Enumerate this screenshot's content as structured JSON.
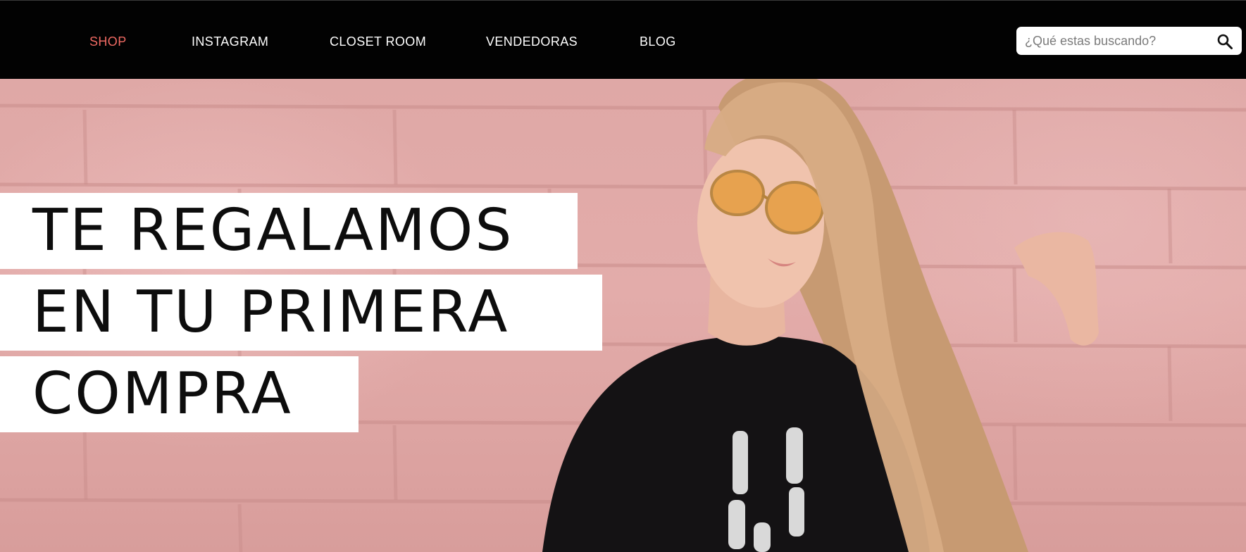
{
  "nav": {
    "items": [
      {
        "label": "SHOP",
        "active": true
      },
      {
        "label": "INSTAGRAM",
        "active": false
      },
      {
        "label": "CLOSET ROOM",
        "active": false
      },
      {
        "label": "VENDEDORAS",
        "active": false
      },
      {
        "label": "BLOG",
        "active": false
      }
    ],
    "active_color": "#f06a63",
    "background": "#020202"
  },
  "search": {
    "placeholder": "¿Qué estas buscando?",
    "value": "",
    "icon": "search-icon"
  },
  "hero": {
    "headline_lines": [
      "TE REGALAMOS",
      "EN TU PRIMERA",
      "COMPRA"
    ],
    "wall_color": "#e0a9a7",
    "image_subject": "woman-with-sunglasses-photo"
  }
}
